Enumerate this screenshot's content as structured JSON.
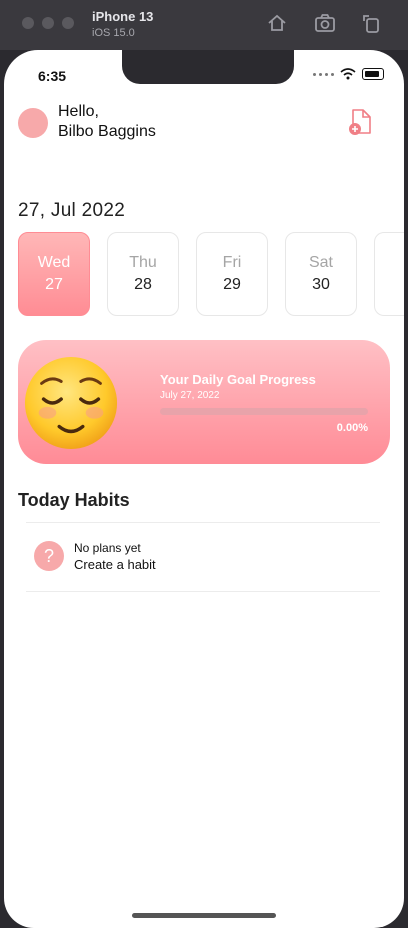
{
  "simulator": {
    "device": "iPhone 13",
    "os": "iOS 15.0"
  },
  "status_bar": {
    "time": "6:35"
  },
  "header": {
    "greeting": "Hello,",
    "name": "Bilbo Baggins"
  },
  "date_title": "27, Jul 2022",
  "days": [
    {
      "name": "Wed",
      "num": "27",
      "active": true
    },
    {
      "name": "Thu",
      "num": "28",
      "active": false
    },
    {
      "name": "Fri",
      "num": "29",
      "active": false
    },
    {
      "name": "Sat",
      "num": "30",
      "active": false
    }
  ],
  "goal": {
    "title": "Your Daily Goal Progress",
    "date": "July 27, 2022",
    "percent_label": "0.00%",
    "progress": 0
  },
  "today_habits": {
    "title": "Today Habits",
    "empty_line1": "No plans yet",
    "empty_line2": "Create a habit"
  },
  "colors": {
    "accent": "#ff8c94",
    "avatar": "#f7a9aa"
  }
}
